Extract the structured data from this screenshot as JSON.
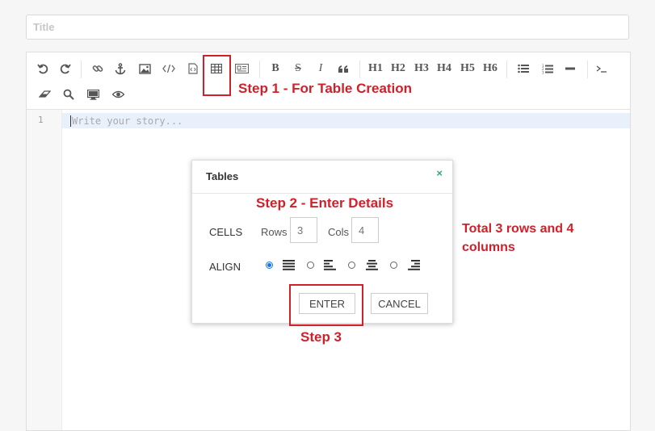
{
  "title_field": {
    "placeholder": "Title",
    "value": ""
  },
  "toolbar": {
    "buttons": [
      {
        "name": "undo-icon"
      },
      {
        "name": "redo-icon"
      },
      {
        "name": "link-icon"
      },
      {
        "name": "anchor-icon"
      },
      {
        "name": "image-icon"
      },
      {
        "name": "code-icon"
      },
      {
        "name": "code-block-icon"
      },
      {
        "name": "table-icon"
      },
      {
        "name": "datetime-icon"
      },
      {
        "name": "bold-icon",
        "label": "B"
      },
      {
        "name": "strikethrough-icon",
        "label": "S"
      },
      {
        "name": "italic-icon",
        "label": "I"
      },
      {
        "name": "quote-icon"
      },
      {
        "name": "h1-button",
        "label": "H1"
      },
      {
        "name": "h2-button",
        "label": "H2"
      },
      {
        "name": "h3-button",
        "label": "H3"
      },
      {
        "name": "h4-button",
        "label": "H4"
      },
      {
        "name": "h5-button",
        "label": "H5"
      },
      {
        "name": "h6-button",
        "label": "H6"
      },
      {
        "name": "unordered-list-icon"
      },
      {
        "name": "ordered-list-icon"
      },
      {
        "name": "horizontal-rule-icon"
      },
      {
        "name": "terminal-icon"
      },
      {
        "name": "eraser-icon"
      },
      {
        "name": "search-icon"
      },
      {
        "name": "preview-desktop-icon"
      },
      {
        "name": "watch-eye-icon"
      }
    ]
  },
  "editor": {
    "line_number": "1",
    "placeholder": "Write your story..."
  },
  "dialog": {
    "title": "Tables",
    "close_icon": "×",
    "cells_label": "CELLS",
    "rows_label": "Rows",
    "rows_placeholder": "3",
    "cols_label": "Cols",
    "cols_placeholder": "4",
    "align_label": "ALIGN",
    "align_options": [
      {
        "name": "justify",
        "selected": true
      },
      {
        "name": "left",
        "selected": false
      },
      {
        "name": "center",
        "selected": false
      },
      {
        "name": "right",
        "selected": false
      }
    ],
    "enter_label": "ENTER",
    "cancel_label": "CANCEL"
  },
  "annotations": {
    "step1": "Step 1 - For Table Creation",
    "step2": "Step 2 - Enter Details",
    "step3": "Step 3",
    "total_line1": "Total 3 rows and 4",
    "total_line2": "columns",
    "color": "#d0202a"
  }
}
